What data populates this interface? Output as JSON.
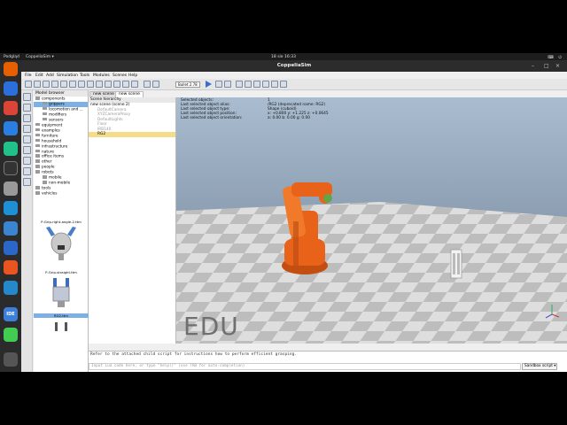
{
  "topbar": {
    "activities": "Podgląd",
    "app_menu": "CoppeliaSim ▾",
    "clock": "18 sie  16:33",
    "tray": "⌨ ⏻"
  },
  "window": {
    "title": "CoppeliaSim",
    "minimize": "–",
    "maximize": "□",
    "close": "×"
  },
  "menu": [
    "File",
    "Edit",
    "Add",
    "Simulation",
    "Tools",
    "Modules",
    "Scenes",
    "Help"
  ],
  "toolbar": {
    "physics_engine": "Bullet 2.78"
  },
  "model_browser": {
    "title": "Model browser",
    "items": [
      {
        "label": "components",
        "level": 0,
        "expanded": true
      },
      {
        "label": "grippers",
        "level": 1,
        "selected": true
      },
      {
        "label": "locomotion and ...",
        "level": 1
      },
      {
        "label": "modifiers",
        "level": 1
      },
      {
        "label": "sensors",
        "level": 1
      },
      {
        "label": "equipment",
        "level": 0
      },
      {
        "label": "examples",
        "level": 0
      },
      {
        "label": "furniture",
        "level": 0
      },
      {
        "label": "household",
        "level": 0
      },
      {
        "label": "infrastructure",
        "level": 0
      },
      {
        "label": "nature",
        "level": 0
      },
      {
        "label": "office items",
        "level": 0
      },
      {
        "label": "other",
        "level": 0
      },
      {
        "label": "people",
        "level": 0
      },
      {
        "label": "robots",
        "level": 0,
        "expanded": true
      },
      {
        "label": "mobile",
        "level": 1
      },
      {
        "label": "non-mobile",
        "level": 1
      },
      {
        "label": "tools",
        "level": 0
      },
      {
        "label": "vehicles",
        "level": 0
      }
    ],
    "thumbnails": [
      {
        "caption": "P-Grip-right-angle-2.ttm"
      },
      {
        "caption": "P-Grip-straight.ttm"
      },
      {
        "caption": "RG2.ttm"
      }
    ]
  },
  "scene_tabs": [
    "new scene",
    "new scene"
  ],
  "scene_hierarchy": {
    "title": "Scene hierarchy",
    "items": [
      {
        "label": "new scene (scene 2)",
        "style": "root"
      },
      {
        "label": "DefaultCamera",
        "style": "dim"
      },
      {
        "label": "XYZCameraProxy",
        "style": "dim"
      },
      {
        "label": "DefaultLights",
        "style": "dim"
      },
      {
        "label": "Floor",
        "style": "dim"
      },
      {
        "label": "IRB140",
        "style": "dim"
      },
      {
        "label": "RG2",
        "style": "robot"
      }
    ]
  },
  "selection_info": {
    "rows": [
      {
        "label": "Selected objects:",
        "value": "1"
      },
      {
        "label": "Last selected object alias:",
        "value": "/RG2   (deprecated name: RG2)"
      },
      {
        "label": "Last selected object type:",
        "value": "Shape (cuboid)"
      },
      {
        "label": "Last selected object position:",
        "value": "x: +0.800   y: +1.225   z: +0.0645"
      },
      {
        "label": "Last selected object orientation:",
        "value": "a: 0.00   b: 0.00   g: 0.00"
      }
    ]
  },
  "watermark": "EDU",
  "console": {
    "message": "Refer to the attached child script for instructions how to perform efficient grasping.",
    "placeholder": "Input Lua code here, or type \"help()\" (use TAB for auto-completion)",
    "sandbox_label": "Sandbox script ▾"
  },
  "colors": {
    "robot": "#e8621a",
    "floor_light": "#dedede",
    "floor_dark": "#bdbdbd",
    "selection": "#7db1e6"
  }
}
